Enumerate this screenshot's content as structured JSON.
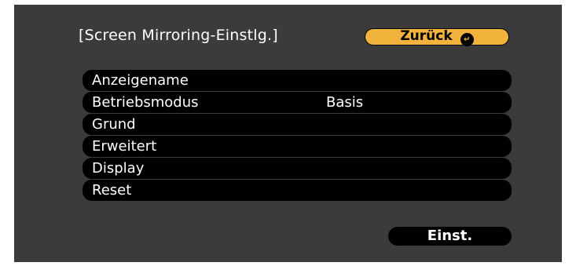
{
  "header": {
    "title": "[Screen Mirroring-Einstlg.]",
    "back_label": "Zurück",
    "back_icon": "enter-icon",
    "back_icon_glyph": "↵"
  },
  "menu": {
    "items": [
      {
        "label": "Anzeigename",
        "value": ""
      },
      {
        "label": "Betriebsmodus",
        "value": "Basis"
      },
      {
        "label": "Grund",
        "value": ""
      },
      {
        "label": "Erweitert",
        "value": ""
      },
      {
        "label": "Display",
        "value": ""
      },
      {
        "label": "Reset",
        "value": ""
      }
    ]
  },
  "footer": {
    "set_label": "Einst."
  },
  "colors": {
    "background": "#3b3b3b",
    "item_background": "#000000",
    "back_button": "#f2b33d",
    "text": "#ffffff"
  }
}
